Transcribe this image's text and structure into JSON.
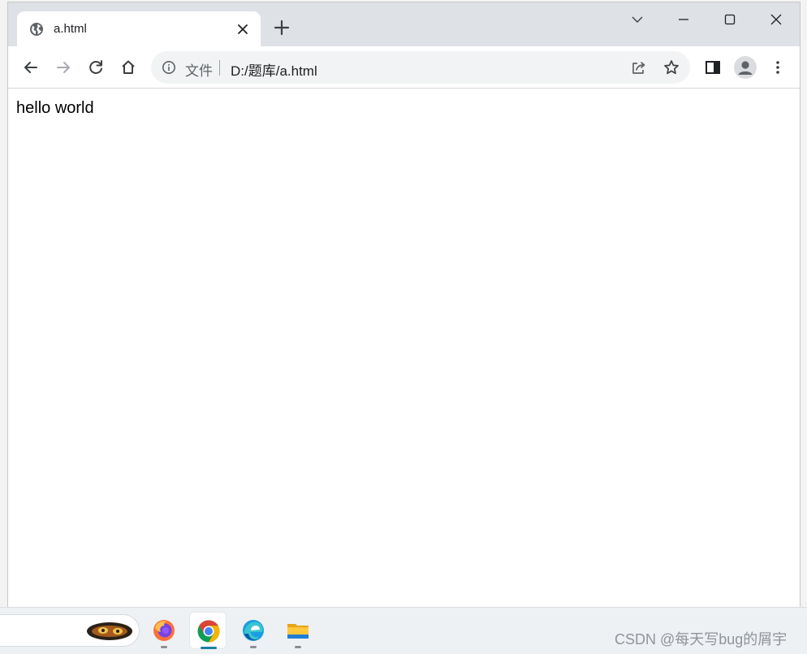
{
  "browser": {
    "tab": {
      "title": "a.html",
      "favicon": "globe-icon"
    },
    "window_controls": [
      "chevron-down-icon",
      "minimize-icon",
      "maximize-icon",
      "close-icon"
    ],
    "toolbar": {
      "back": "arrow-left-icon",
      "forward": "arrow-right-icon",
      "reload": "reload-icon",
      "home": "home-icon"
    },
    "omnibox": {
      "chip_label": "文件",
      "url": "D:/题库/a.html",
      "actions": [
        "share-icon",
        "star-icon"
      ]
    },
    "side_panel": "side-panel-icon",
    "profile": "avatar-icon",
    "menu": "more-vert-icon"
  },
  "page": {
    "text": "hello world"
  },
  "taskbar": {
    "apps": [
      "firefox-icon",
      "chrome-icon",
      "edge-icon",
      "file-explorer-icon"
    ],
    "active_app": "chrome-icon",
    "watermark": "CSDN @每天写bug的屑宇"
  },
  "colors": {
    "tabstrip_bg": "#dee1e6",
    "omnibox_bg": "#f1f3f4",
    "taskbar_bg": "#eef1f4",
    "chrome_red": "#db4437",
    "chrome_green": "#0f9d58",
    "chrome_yellow": "#f4b400",
    "chrome_blue": "#4285f4"
  }
}
